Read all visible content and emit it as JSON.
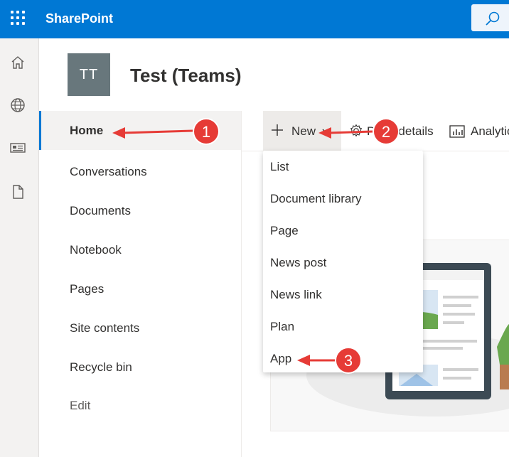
{
  "app": {
    "brand": "SharePoint"
  },
  "site": {
    "logo_initials": "TT",
    "title": "Test (Teams)"
  },
  "leftnav": {
    "items": [
      {
        "label": "Home",
        "selected": true
      },
      {
        "label": "Conversations"
      },
      {
        "label": "Documents"
      },
      {
        "label": "Notebook"
      },
      {
        "label": "Pages"
      },
      {
        "label": "Site contents"
      },
      {
        "label": "Recycle bin"
      },
      {
        "label": "Edit"
      }
    ]
  },
  "commandbar": {
    "new_label": "New",
    "page_details_label": "Page details",
    "analytics_label": "Analytics"
  },
  "new_menu": {
    "items": [
      "List",
      "Document library",
      "Page",
      "News post",
      "News link",
      "Plan",
      "App"
    ]
  },
  "annotations": {
    "step1": "1",
    "step2": "2",
    "step3": "3"
  },
  "colors": {
    "brand": "#0078d4",
    "callout": "#e63b36"
  },
  "icons": {
    "app_launcher": "waffle-icon",
    "search": "search-icon",
    "rail": [
      "home-icon",
      "globe-icon",
      "news-icon",
      "document-icon"
    ]
  }
}
